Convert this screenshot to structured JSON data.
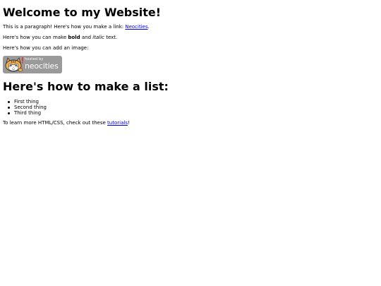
{
  "heading": "Welcome to my Website!",
  "paragraph1": {
    "before": "This is a paragraph! Here's how you make a link: ",
    "link": "Neocities",
    "after": "."
  },
  "paragraph2": {
    "before": "Here's how you can make ",
    "bold": "bold",
    "middle": " and ",
    "italic": "italic",
    "after": " text."
  },
  "paragraph3": "Here's how you can add an image:",
  "badge": {
    "small_text": "hosted by",
    "big_text": "neocities",
    "icon": "neocities-cat-icon",
    "background": "#9a9a9a"
  },
  "list_heading": "Here's how to make a list:",
  "list_items": [
    "First thing",
    "Second thing",
    "Third thing"
  ],
  "paragraph4": {
    "before": "To learn more HTML/CSS, check out these ",
    "link": "tutorials",
    "after": "!"
  },
  "colors": {
    "link": "#0000ee",
    "text": "#000000",
    "background": "#ffffff"
  }
}
